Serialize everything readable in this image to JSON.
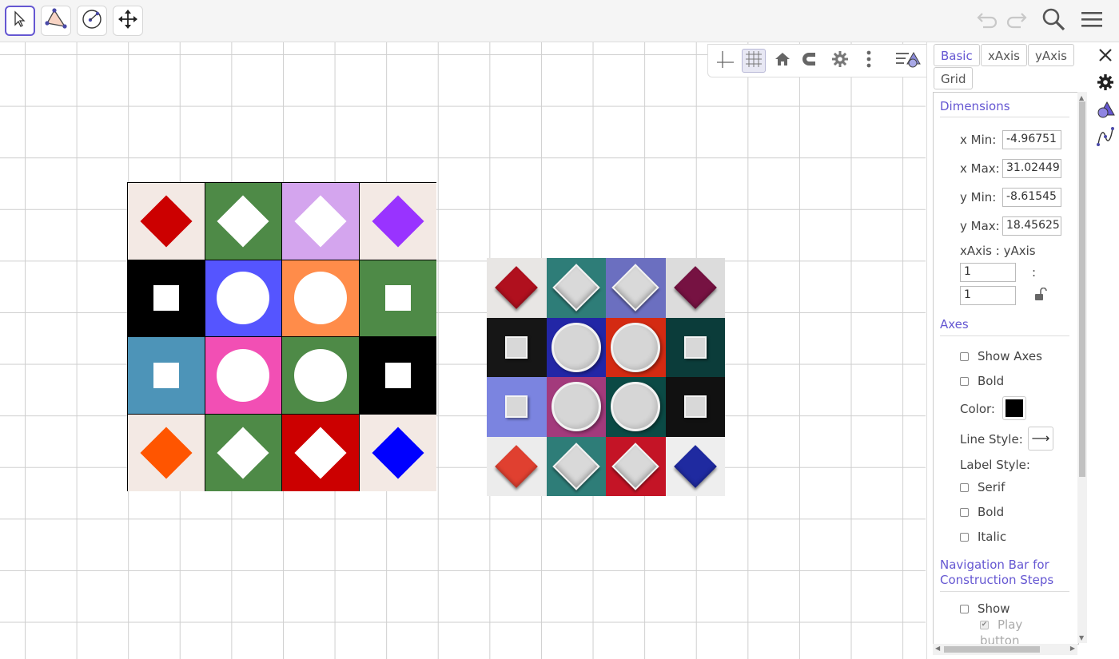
{
  "toolbar": {
    "tools": [
      {
        "name": "move-tool",
        "icon": "cursor-arrow-icon"
      },
      {
        "name": "polygon-tool",
        "icon": "triangle-points-icon"
      },
      {
        "name": "circle-tool",
        "icon": "circle-center-icon"
      },
      {
        "name": "move-graphics-tool",
        "icon": "four-arrows-icon"
      }
    ],
    "right_icons": [
      "undo-icon",
      "redo-icon",
      "search-icon",
      "menu-icon"
    ]
  },
  "stylebar": {
    "buttons": [
      "axes-toggle-icon",
      "grid-toggle-icon",
      "home-icon",
      "magnet-icon",
      "gear-icon",
      "more-vertical-icon"
    ],
    "toggle_icon": "style-bar-toggle-icon"
  },
  "tiles": {
    "rows": [
      [
        {
          "bg": "#f3e9e4",
          "shape": "diamond",
          "color": "#cc0000"
        },
        {
          "bg": "#4e8a47",
          "shape": "diamond",
          "color": "#ffffff"
        },
        {
          "bg": "#d4a5ee",
          "shape": "diamond",
          "color": "#ffffff"
        },
        {
          "bg": "#f3e9e4",
          "shape": "diamond",
          "color": "#9933ff"
        }
      ],
      [
        {
          "bg": "#000000",
          "shape": "square",
          "color": "#ffffff"
        },
        {
          "bg": "#5555ff",
          "shape": "circle",
          "color": "#ffffff"
        },
        {
          "bg": "#ff8c4a",
          "shape": "circle",
          "color": "#ffffff"
        },
        {
          "bg": "#4e8a47",
          "shape": "square",
          "color": "#ffffff"
        }
      ],
      [
        {
          "bg": "#4d94b8",
          "shape": "square",
          "color": "#ffffff"
        },
        {
          "bg": "#f24fb4",
          "shape": "circle",
          "color": "#ffffff"
        },
        {
          "bg": "#4e8a47",
          "shape": "circle",
          "color": "#ffffff"
        },
        {
          "bg": "#000000",
          "shape": "square",
          "color": "#ffffff"
        }
      ],
      [
        {
          "bg": "#f3e9e4",
          "shape": "diamond",
          "color": "#ff5500"
        },
        {
          "bg": "#4e8a47",
          "shape": "diamond",
          "color": "#ffffff"
        },
        {
          "bg": "#cc0000",
          "shape": "diamond",
          "color": "#ffffff"
        },
        {
          "bg": "#f3e9e4",
          "shape": "diamond",
          "color": "#0000ff"
        }
      ]
    ]
  },
  "photo": {
    "rows": [
      [
        {
          "bg": "#e8e6e4",
          "shape": "diamond",
          "color": "#b0101e"
        },
        {
          "bg": "#2e7d78",
          "shape": "diamond-light",
          "color": "#d8d8d8"
        },
        {
          "bg": "#6b6fc0",
          "shape": "diamond-light",
          "color": "#d8d8d8"
        },
        {
          "bg": "#dcdcdc",
          "shape": "diamond",
          "color": "#761242"
        }
      ],
      [
        {
          "bg": "#161616",
          "shape": "square",
          "color": "#d8d8d8"
        },
        {
          "bg": "#2226a6",
          "shape": "circle",
          "color": "#d8d8d8"
        },
        {
          "bg": "#d42a12",
          "shape": "circle",
          "color": "#d8d8d8"
        },
        {
          "bg": "#0b3c3a",
          "shape": "square",
          "color": "#d8d8d8"
        }
      ],
      [
        {
          "bg": "#7b84e0",
          "shape": "square",
          "color": "#d8d8d8"
        },
        {
          "bg": "#a33a7c",
          "shape": "circle",
          "color": "#d8d8d8"
        },
        {
          "bg": "#0b4a45",
          "shape": "circle",
          "color": "#d8d8d8"
        },
        {
          "bg": "#111111",
          "shape": "square",
          "color": "#d8d8d8"
        }
      ],
      [
        {
          "bg": "#ececec",
          "shape": "diamond",
          "color": "#e04030"
        },
        {
          "bg": "#2e7d78",
          "shape": "diamond-light",
          "color": "#d8d8d8"
        },
        {
          "bg": "#c41426",
          "shape": "diamond-light",
          "color": "#d8d8d8"
        },
        {
          "bg": "#eeeeee",
          "shape": "diamond",
          "color": "#1f2aa0"
        }
      ]
    ]
  },
  "panel": {
    "tabs": {
      "basic": "Basic",
      "xaxis": "xAxis",
      "yaxis": "yAxis",
      "grid": "Grid"
    },
    "dimensions": {
      "title": "Dimensions",
      "xmin_label": "x Min:",
      "xmin": "-4.96751",
      "xmax_label": "x Max:",
      "xmax": "31.02449",
      "ymin_label": "y Min:",
      "ymin": "-8.61545",
      "ymax_label": "y Max:",
      "ymax": "18.45625",
      "ratio_label": "xAxis : yAxis",
      "ratio_x": "1",
      "ratio_sep": ":",
      "ratio_y": "1"
    },
    "axes": {
      "title": "Axes",
      "show_axes": "Show Axes",
      "bold": "Bold",
      "color_label": "Color:",
      "color": "#000000",
      "line_style_label": "Line Style:",
      "line_style_value": "⟶",
      "label_style": "Label Style:",
      "serif": "Serif",
      "bold2": "Bold",
      "italic": "Italic"
    },
    "nav": {
      "title_line1": "Navigation Bar for",
      "title_line2": "Construction Steps",
      "show": "Show",
      "play_line1": "Play",
      "play_line2": "button"
    },
    "side_icons": [
      "close-icon",
      "gear-icon",
      "graphics-view-icon",
      "algebra-graph-icon"
    ]
  }
}
